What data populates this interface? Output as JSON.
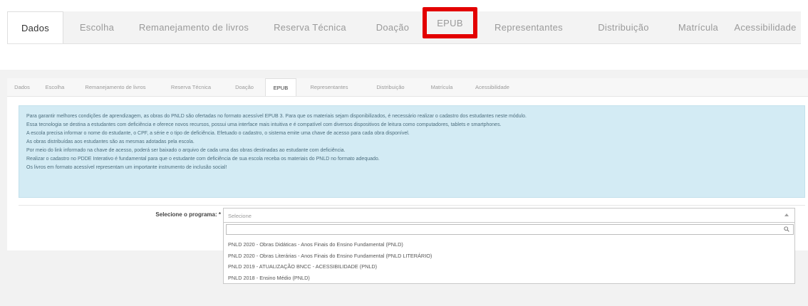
{
  "top_tabs": {
    "items": [
      {
        "label": "Dados"
      },
      {
        "label": "Escolha"
      },
      {
        "label": "Remanejamento de livros"
      },
      {
        "label": "Reserva Técnica"
      },
      {
        "label": "Doação"
      },
      {
        "label": "EPUB"
      },
      {
        "label": "Representantes"
      },
      {
        "label": "Distribuição"
      },
      {
        "label": "Matrícula"
      },
      {
        "label": "Acessibilidade"
      }
    ],
    "active": "Dados",
    "highlighted": "EPUB",
    "highlight_color": "#e30000"
  },
  "panel_tabs": {
    "items": [
      {
        "label": "Dados"
      },
      {
        "label": "Escolha"
      },
      {
        "label": "Remanejamento de livros"
      },
      {
        "label": "Reserva Técnica"
      },
      {
        "label": "Doação"
      },
      {
        "label": "EPUB"
      },
      {
        "label": "Representantes"
      },
      {
        "label": "Distribuição"
      },
      {
        "label": "Matrícula"
      },
      {
        "label": "Acessibilidade"
      }
    ],
    "active": "EPUB"
  },
  "info": {
    "lines": [
      "Para garantir melhores condições de aprendizagem, as obras do PNLD são ofertadas no formato acessível EPUB 3. Para que os materiais sejam disponibilizados, é necessário realizar o cadastro dos estudantes neste módulo.",
      "Essa tecnologia se destina a estudantes com deficiência e oferece novos recursos, possui uma interface mais intuitiva e é compatível com diversos dispositivos de leitura como computadores, tablets e smartphones.",
      "A escola precisa informar o nome do estudante, o CPF, a série e o tipo de deficiência. Efetuado o cadastro, o sistema emite uma chave de acesso para cada obra disponível.",
      "As obras distribuídas aos estudantes são as mesmas adotadas pela escola.",
      "Por meio do link informado na chave de acesso, poderá ser baixado o arquivo de cada uma das obras destinadas ao estudante com deficiência.",
      "Realizar o cadastro no PDDE Interativo é fundamental para que o estudante com deficiência de sua escola receba os materiais do PNLD no formato adequado.",
      "Os livros em formato acessível representam um importante instrumento de inclusão social!"
    ],
    "background": "#d3ebf4"
  },
  "form": {
    "program_label": "Selecione o programa: *",
    "select_placeholder": "Selecione",
    "options": [
      "PNLD 2020 - Obras Didáticas - Anos Finais do Ensino Fundamental (PNLD)",
      "PNLD 2020 - Obras Literárias - Anos Finais do Ensino Fundamental (PNLD LITERÁRIO)",
      "PNLD 2019 - ATUALIZAÇÃO BNCC - ACESSIBILIDADE (PNLD)",
      "PNLD 2018 - Ensino Médio (PNLD)"
    ]
  }
}
